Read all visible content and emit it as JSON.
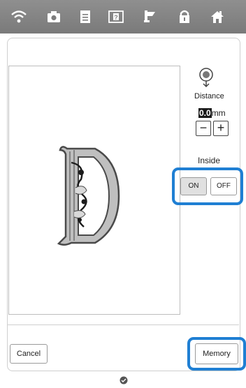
{
  "topbar": {
    "icons": [
      "wifi-icon",
      "camera-icon",
      "document-icon",
      "help-icon",
      "embroidery-foot-icon",
      "lock-icon",
      "home-icon"
    ]
  },
  "settings": {
    "distance_label": "Distance",
    "distance_value": "0.0",
    "distance_unit": "mm",
    "minus_label": "−",
    "plus_label": "+",
    "inside_label": "Inside",
    "on_label": "ON",
    "off_label": "OFF",
    "selected": "ON"
  },
  "footer": {
    "cancel_label": "Cancel",
    "memory_label": "Memory"
  },
  "colors": {
    "highlight": "#1f7fd3",
    "topbar": "#868686"
  }
}
